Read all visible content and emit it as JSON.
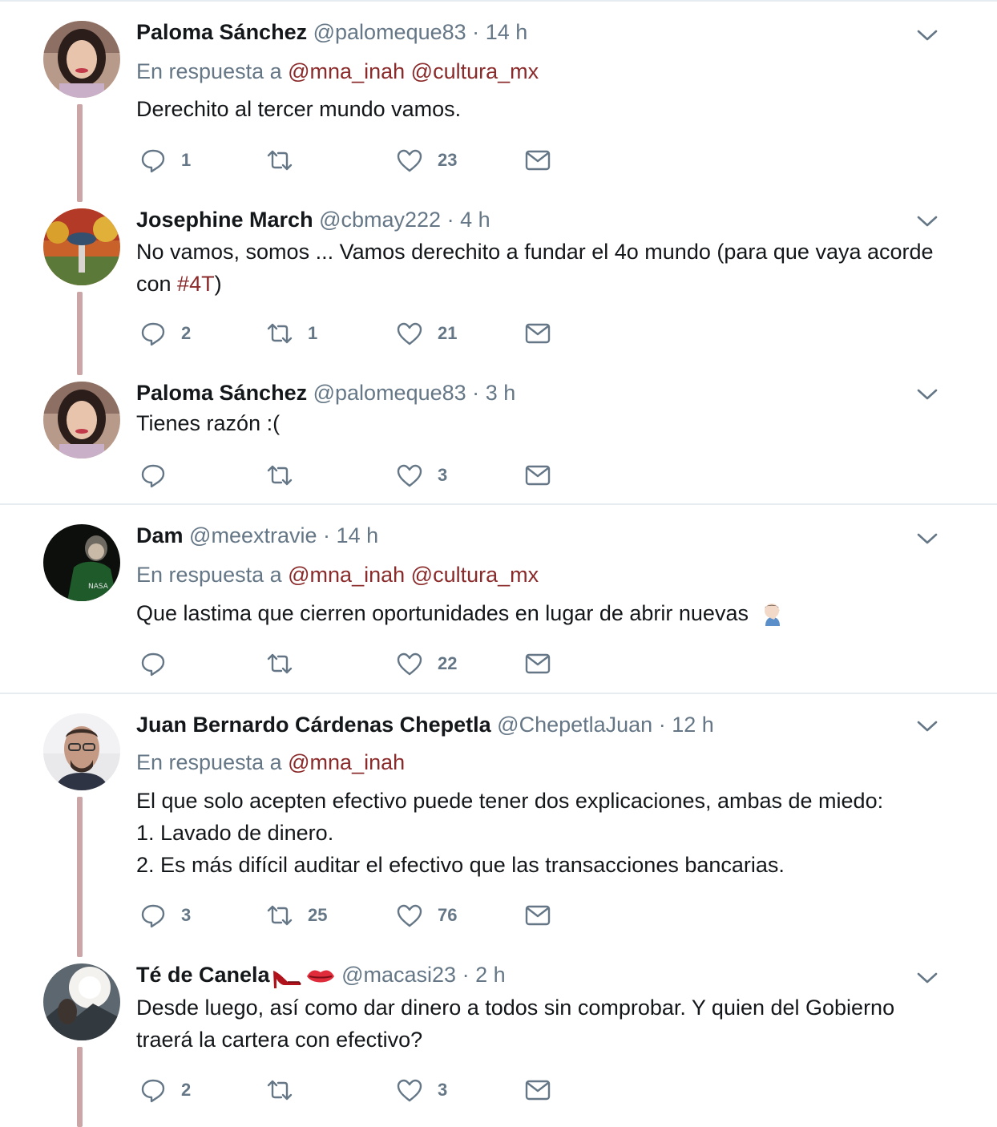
{
  "reply_prefix": "En respuesta a",
  "tweets": [
    {
      "name": "Paloma Sánchez",
      "handle": "@palomeque83",
      "time": "14 h",
      "reply_mentions": [
        "@mna_inah",
        "@cultura_mx"
      ],
      "text": "Derechito al tercer mundo vamos.",
      "replies": "1",
      "retweets": "",
      "likes": "23"
    },
    {
      "name": "Josephine March",
      "handle": "@cbmay222",
      "time": "4 h",
      "text_before": "No vamos, somos ... Vamos derechito a fundar el 4o mundo (para que vaya acorde con ",
      "hashtag": "#4T",
      "text_after": ")",
      "replies": "2",
      "retweets": "1",
      "likes": "21"
    },
    {
      "name": "Paloma Sánchez",
      "handle": "@palomeque83",
      "time": "3 h",
      "text": "Tienes razón :(",
      "replies": "",
      "retweets": "",
      "likes": "3"
    },
    {
      "name": "Dam",
      "handle": "@meextravie",
      "time": "14 h",
      "reply_mentions": [
        "@mna_inah",
        "@cultura_mx"
      ],
      "text": "Que lastima que cierren oportunidades en lugar de abrir nuevas",
      "emoji": "facepalm-emoji",
      "replies": "",
      "retweets": "",
      "likes": "22"
    },
    {
      "name": "Juan Bernardo Cárdenas Chepetla",
      "handle": "@ChepetlaJuan",
      "time": "12 h",
      "reply_mentions": [
        "@mna_inah"
      ],
      "lines": [
        "El que solo acepten efectivo puede tener dos explicaciones, ambas de miedo:",
        "1. Lavado de dinero.",
        "2. Es más difícil auditar el efectivo que las transacciones bancarias."
      ],
      "replies": "3",
      "retweets": "25",
      "likes": "76"
    },
    {
      "name": "Té de Canela",
      "name_emojis": [
        "high-heel-emoji",
        "kiss-lips-emoji"
      ],
      "handle": "@macasi23",
      "time": "2 h",
      "text": "Desde luego, así como dar dinero a todos sin  comprobar. Y quien del Gobierno traerá la cartera con efectivo?",
      "replies": "2",
      "retweets": "",
      "likes": "3"
    }
  ],
  "icons": {
    "reply": "reply-icon",
    "retweet": "retweet-icon",
    "like": "heart-icon",
    "dm": "envelope-icon",
    "more": "chevron-down-icon"
  },
  "colors": {
    "text": "#14171a",
    "secondary": "#657786",
    "mention": "#8b2a2a",
    "thread_line": "#cba6a6",
    "divider": "#e6ecf0"
  }
}
